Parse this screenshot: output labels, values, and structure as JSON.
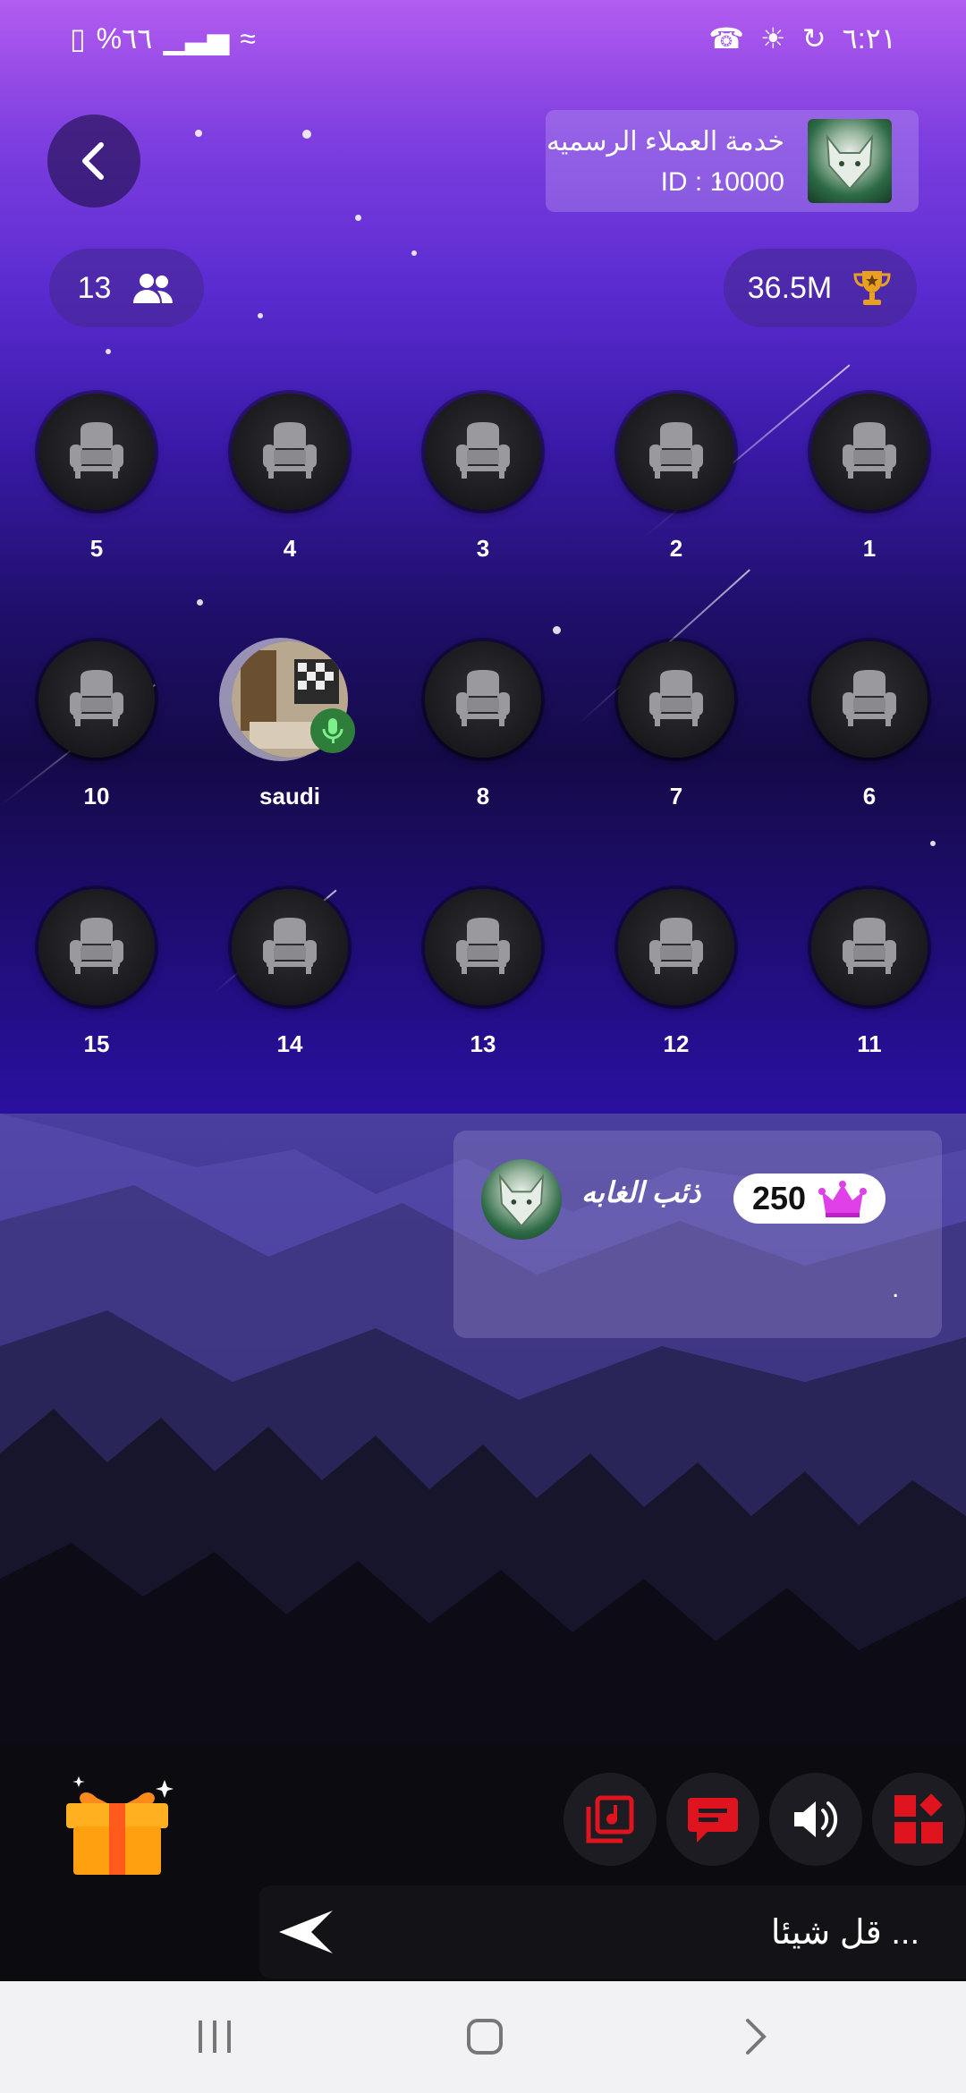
{
  "status_bar": {
    "battery": "%٦٦",
    "time": "٦:٢١"
  },
  "header": {
    "room_title": "خدمة العملاء الرسميه",
    "room_id": "ID : 10000",
    "users_count": "13",
    "trophy_value": "36.5M"
  },
  "seats": [
    {
      "label": "1",
      "occupied": false
    },
    {
      "label": "2",
      "occupied": false
    },
    {
      "label": "3",
      "occupied": false
    },
    {
      "label": "4",
      "occupied": false
    },
    {
      "label": "5",
      "occupied": false
    },
    {
      "label": "6",
      "occupied": false
    },
    {
      "label": "7",
      "occupied": false
    },
    {
      "label": "8",
      "occupied": false
    },
    {
      "label": "saudi",
      "occupied": true
    },
    {
      "label": "10",
      "occupied": false
    },
    {
      "label": "11",
      "occupied": false
    },
    {
      "label": "12",
      "occupied": false
    },
    {
      "label": "13",
      "occupied": false
    },
    {
      "label": "14",
      "occupied": false
    },
    {
      "label": "15",
      "occupied": false
    }
  ],
  "chat": {
    "sender_name": "ذئب الغابه",
    "level_badge": "250",
    "message_text": "."
  },
  "composer": {
    "placeholder": "قل شيئا ..."
  },
  "colors": {
    "accent_red": "#e0141e",
    "crown_pink": "#e040e8",
    "trophy_gold": "#e8a020"
  },
  "icons": {
    "back": "chevron-left-icon",
    "users": "users-icon",
    "trophy": "trophy-icon",
    "seat": "armchair-icon",
    "mic": "mic-icon",
    "gift": "gift-icon",
    "music": "music-icon",
    "chat": "chat-icon",
    "volume": "volume-icon",
    "apps": "apps-icon",
    "send": "send-icon"
  }
}
